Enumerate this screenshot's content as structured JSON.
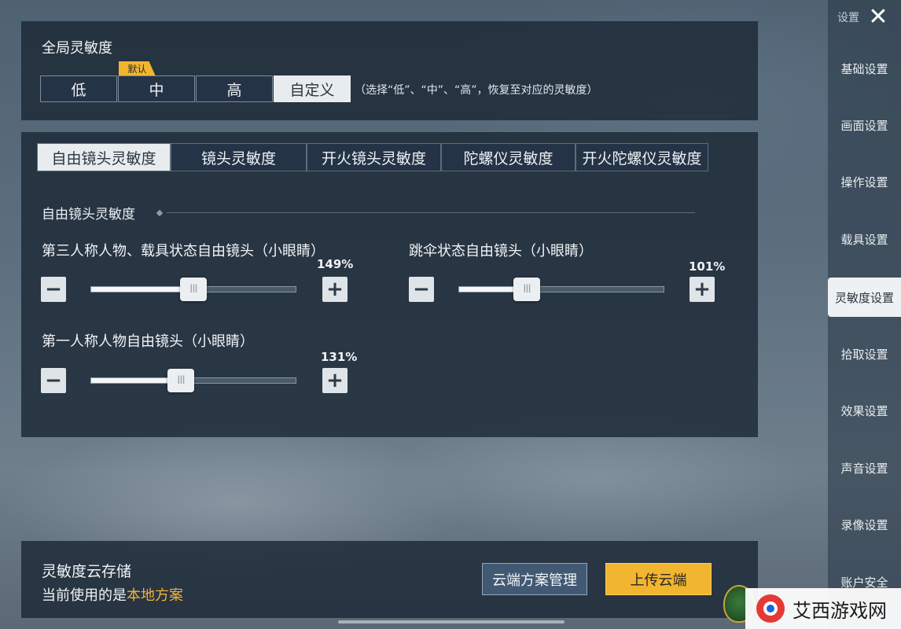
{
  "sensitivity": {
    "title": "全局灵敏度",
    "presets": [
      "低",
      "中",
      "高",
      "自定义"
    ],
    "selected_preset": "自定义",
    "default_badge": "默认",
    "hint": "（选择“低”、“中”、“高”，恢复至对应的灵敏度）"
  },
  "tabs": [
    "自由镜头灵敏度",
    "镜头灵敏度",
    "开火镜头灵敏度",
    "陀螺仪灵敏度",
    "开火陀螺仪灵敏度"
  ],
  "active_tab": "自由镜头灵敏度",
  "section": {
    "heading": "自由镜头灵敏度",
    "sliders": [
      {
        "label": "第三人称人物、载具状态自由镜头（小眼睛）",
        "value_text": "149%",
        "fraction": 0.5
      },
      {
        "label": "跳伞状态自由镜头（小眼睛）",
        "value_text": "101%",
        "fraction": 0.33
      },
      {
        "label": "第一人称人物自由镜头（小眼睛）",
        "value_text": "131%",
        "fraction": 0.44
      }
    ],
    "minus_symbol": "−",
    "plus_symbol": "+",
    "thumb_grip": "III"
  },
  "sidebar": {
    "title": "设置",
    "close_symbol": "✕",
    "items": [
      "基础设置",
      "画面设置",
      "操作设置",
      "载具设置",
      "灵敏度设置",
      "拾取设置",
      "效果设置",
      "声音设置",
      "录像设置",
      "账户安全"
    ],
    "active_item": "灵敏度设置"
  },
  "cloud": {
    "title": "灵敏度云存储",
    "desc_prefix": "当前使用的是",
    "desc_highlight": "本地方案",
    "manage_button": "云端方案管理",
    "upload_button": "上传云端"
  },
  "watermark": {
    "text": "艾西游戏网"
  },
  "colors": {
    "accent_gold": "#f1b52f",
    "highlight_text": "#f0b33a",
    "panel_bg": "#1c2836"
  },
  "icons": {
    "close": "close-icon",
    "minus": "minus-icon",
    "plus": "plus-icon",
    "slider_grip": "slider-grip-icon"
  }
}
